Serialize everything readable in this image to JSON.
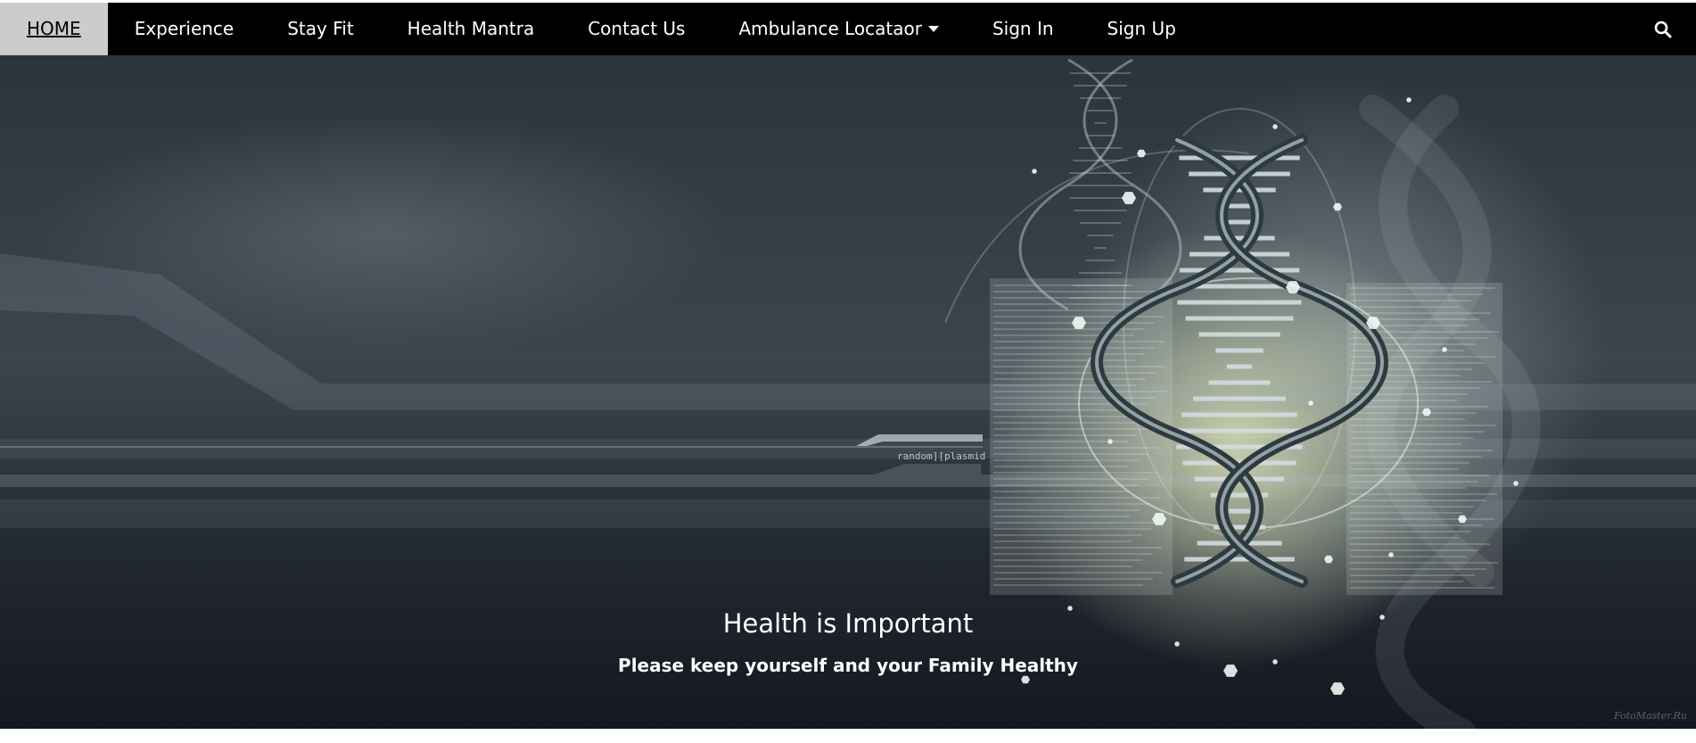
{
  "nav": {
    "items": [
      {
        "label": "HOME",
        "active": true
      },
      {
        "label": "Experience"
      },
      {
        "label": "Stay Fit"
      },
      {
        "label": "Health Mantra"
      },
      {
        "label": "Contact Us"
      },
      {
        "label": "Ambulance Locataor",
        "has_dropdown": true
      },
      {
        "label": "Sign In"
      },
      {
        "label": "Sign Up"
      }
    ],
    "search_icon": "search-icon"
  },
  "hero": {
    "title": "Health is Important",
    "subtitle": "Please keep yourself and your Family Healthy",
    "image_text": "random][plasmid",
    "watermark": "FotoMaster.Ru"
  },
  "colors": {
    "nav_bg": "#000000",
    "nav_active_bg": "#cccccc",
    "nav_text": "#ffffff",
    "hero_text": "#ffffff"
  }
}
